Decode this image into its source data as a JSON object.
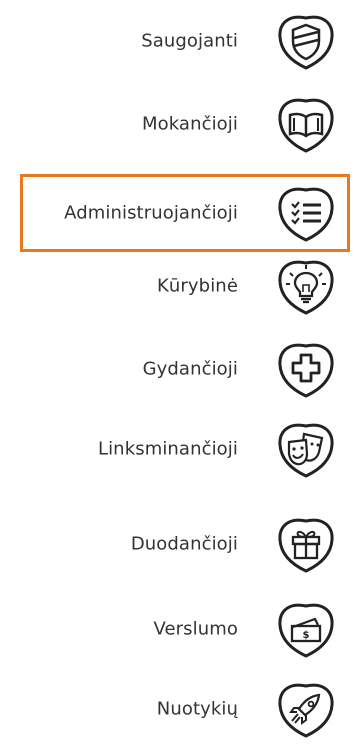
{
  "items": [
    {
      "label": "Saugojanti",
      "icon": "shield-icon",
      "selected": false
    },
    {
      "label": "Mokančioji",
      "icon": "book-icon",
      "selected": false
    },
    {
      "label": "Administruojančioji",
      "icon": "checklist-icon",
      "selected": true
    },
    {
      "label": "Kūrybinė",
      "icon": "lightbulb-icon",
      "selected": false
    },
    {
      "label": "Gydančioji",
      "icon": "plus-cross-icon",
      "selected": false
    },
    {
      "label": "Linksminančioji",
      "icon": "theater-masks-icon",
      "selected": false
    },
    {
      "label": "Duodančioji",
      "icon": "gift-icon",
      "selected": false
    },
    {
      "label": "Verslumo",
      "icon": "money-icon",
      "selected": false
    },
    {
      "label": "Nuotykių",
      "icon": "rocket-icon",
      "selected": false
    }
  ],
  "colors": {
    "selection_border": "#e8791f",
    "stroke": "#222222",
    "text": "#333333"
  }
}
